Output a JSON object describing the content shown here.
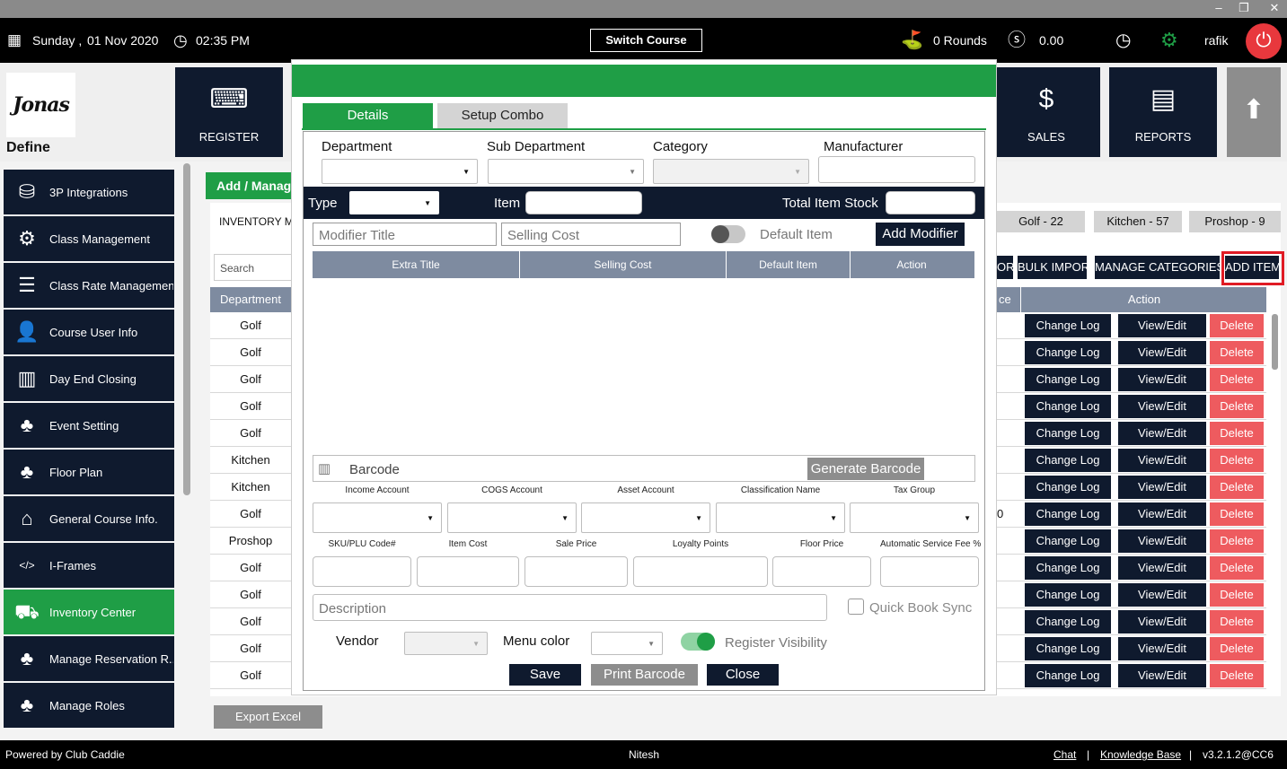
{
  "window": {
    "controls": [
      "–",
      "❐",
      "✕"
    ]
  },
  "topbar": {
    "day": "Sunday ,",
    "date": "01 Nov 2020",
    "time": "02:35 PM",
    "switch_course": "Switch Course",
    "rounds": "0 Rounds",
    "amount": "0.00",
    "user": "rafik"
  },
  "logo_text": "Jonas",
  "define_label": "Define",
  "tiles": {
    "register": "REGISTER",
    "sales": "SALES",
    "reports": "REPORTS"
  },
  "sidebar": {
    "items": [
      {
        "label": "3P Integrations",
        "icon": "integrations-icon"
      },
      {
        "label": "Class Management",
        "icon": "class-management-icon"
      },
      {
        "label": "Class Rate Management",
        "icon": "rate-list-icon"
      },
      {
        "label": "Course User Info",
        "icon": "user-icon"
      },
      {
        "label": "Day End Closing",
        "icon": "day-end-icon"
      },
      {
        "label": "Event Setting",
        "icon": "org-chart-icon"
      },
      {
        "label": "Floor Plan",
        "icon": "org-chart-icon"
      },
      {
        "label": "General Course Info.",
        "icon": "home-icon"
      },
      {
        "label": "I-Frames",
        "icon": "code-icon"
      },
      {
        "label": "Inventory Center",
        "icon": "inventory-icon"
      },
      {
        "label": "Manage Reservation R...",
        "icon": "org-chart-icon"
      },
      {
        "label": "Manage Roles",
        "icon": "org-chart-icon"
      }
    ]
  },
  "main": {
    "add_manage": "Add / Manage",
    "inventory_label": "INVENTORY MA",
    "search_placeholder": "Search",
    "pills": [
      "Golf - 22",
      "Kitchen - 57",
      "Proshop - 9"
    ],
    "buttons": {
      "export_partial": "ORT",
      "bulk_import": "BULK IMPORT",
      "manage_categories": "MANAGE CATEGORIES",
      "add_item": "ADD ITEM"
    },
    "table": {
      "col_department": "Department",
      "col_partial": "ce",
      "col_action": "Action",
      "rows": [
        "Golf",
        "Golf",
        "Golf",
        "Golf",
        "Golf",
        "Kitchen",
        "Kitchen",
        "Golf",
        "Proshop",
        "Golf",
        "Golf",
        "Golf",
        "Golf",
        "Golf"
      ],
      "row_fragment": {
        "index": 7,
        "text": "0"
      },
      "action_labels": {
        "change_log": "Change Log",
        "view_edit": "View/Edit",
        "delete": "Delete"
      }
    },
    "export_excel": "Export Excel"
  },
  "modal": {
    "tabs": [
      "Details",
      "Setup Combo"
    ],
    "department": "Department",
    "sub_department": "Sub Department",
    "category": "Category",
    "manufacturer": "Manufacturer",
    "type": "Type",
    "item": "Item",
    "total_item_stock": "Total Item Stock",
    "modifier_title_placeholder": "Modifier Title",
    "selling_cost_placeholder": "Selling Cost",
    "default_item": "Default Item",
    "add_modifier": "Add Modifier",
    "modifier_table": {
      "extra_title": "Extra Title",
      "selling_cost": "Selling Cost",
      "default_item": "Default Item",
      "action": "Action"
    },
    "barcode": "Barcode",
    "generate_barcode": "Generate Barcode",
    "accounts": [
      "Income Account",
      "COGS Account",
      "Asset Account",
      "Classification Name",
      "Tax Group"
    ],
    "prices": [
      "SKU/PLU Code#",
      "Item Cost",
      "Sale Price",
      "Loyalty Points",
      "Floor Price",
      "Automatic Service Fee %"
    ],
    "description_placeholder": "Description",
    "quick_book_sync": "Quick Book Sync",
    "vendor": "Vendor",
    "menu_color": "Menu color",
    "register_visibility": "Register Visibility",
    "save": "Save",
    "print_barcode": "Print Barcode",
    "close": "Close"
  },
  "footer": {
    "powered_by": "Powered by Club Caddie",
    "user": "Nitesh",
    "chat": "Chat",
    "sep": "|",
    "knowledge_base": "Knowledge Base",
    "version": "v3.2.1.2@CC6"
  },
  "colors": {
    "green": "#1f9e46",
    "navy": "#0f1a2e",
    "red": "#ee5b5f",
    "header_grey": "#7e8ba0"
  }
}
